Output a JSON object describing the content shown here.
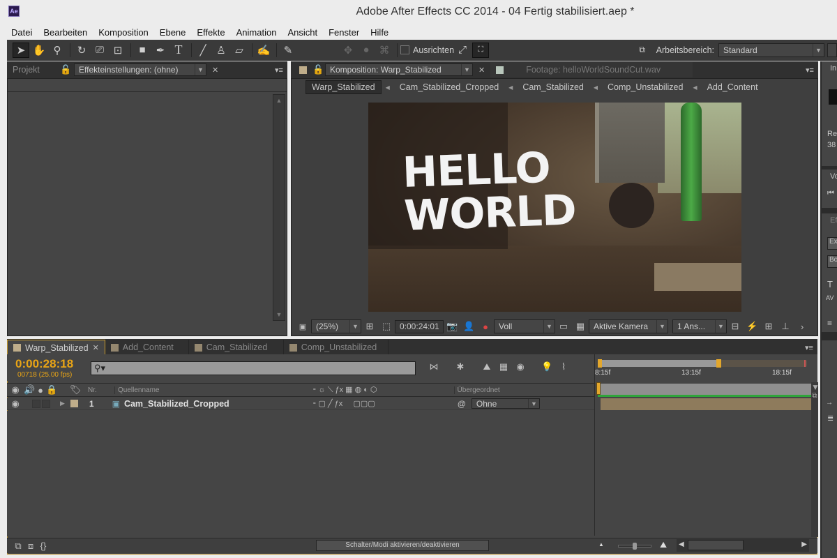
{
  "window": {
    "title": "Adobe After Effects CC 2014 - 04 Fertig stabilisiert.aep *",
    "logo": "Ae"
  },
  "menu": [
    "Datei",
    "Bearbeiten",
    "Komposition",
    "Ebene",
    "Effekte",
    "Animation",
    "Ansicht",
    "Fenster",
    "Hilfe"
  ],
  "toolbar": {
    "tools": [
      {
        "name": "selection-tool-icon",
        "glyph": "➤"
      },
      {
        "name": "hand-tool-icon",
        "glyph": "✋"
      },
      {
        "name": "zoom-tool-icon",
        "glyph": "🔍"
      },
      {
        "name": "rotation-tool-icon",
        "glyph": "↻"
      },
      {
        "name": "camera-tool-icon",
        "glyph": "⎚"
      },
      {
        "name": "pan-behind-tool-icon",
        "glyph": "⊡"
      },
      {
        "name": "rectangle-tool-icon",
        "glyph": "■"
      },
      {
        "name": "pen-tool-icon",
        "glyph": "✒"
      },
      {
        "name": "type-tool-icon",
        "glyph": "T"
      },
      {
        "name": "brush-tool-icon",
        "glyph": "╱"
      },
      {
        "name": "clone-stamp-tool-icon",
        "glyph": "♙"
      },
      {
        "name": "eraser-tool-icon",
        "glyph": "▱"
      },
      {
        "name": "roto-brush-tool-icon",
        "glyph": "✍"
      },
      {
        "name": "puppet-pin-tool-icon",
        "glyph": "📌"
      }
    ],
    "snap_label": "Ausrichten",
    "workspace_label": "Arbeitsbereich:",
    "workspace_value": "Standard"
  },
  "left_panel": {
    "tabs": [
      {
        "label": "Projekt",
        "active": false
      },
      {
        "label": "Effekteinstellungen: (ohne)",
        "active": true
      }
    ]
  },
  "comp_panel": {
    "tab_active": "Komposition: Warp_Stabilized",
    "tab_inactive": "Footage: helloWorldSoundCut.wav",
    "breadcrumbs": [
      "Warp_Stabilized",
      "Cam_Stabilized_Cropped",
      "Cam_Stabilized",
      "Comp_Unstabilized",
      "Add_Content"
    ],
    "viewer_text": [
      "HELLO",
      "WORLD"
    ],
    "zoom": "(25%)",
    "timecode": "0:00:24:01",
    "resolution": "Voll",
    "camera": "Aktive Kamera",
    "views": "1 Ans..."
  },
  "right_panel": {
    "labels": [
      "In",
      "Re",
      "38",
      "Vo",
      "Ef",
      "Ex",
      "Bo"
    ]
  },
  "timeline": {
    "tabs": [
      {
        "label": "Warp_Stabilized",
        "active": true
      },
      {
        "label": "Add_Content",
        "active": false
      },
      {
        "label": "Cam_Stabilized",
        "active": false
      },
      {
        "label": "Comp_Unstabilized",
        "active": false
      }
    ],
    "current_time": "0:00:28:18",
    "frame_info": "00718 (25.00 fps)",
    "search_placeholder": "⚲▾",
    "columns": {
      "nr": "Nr.",
      "source": "Quellenname",
      "parent": "Übergeordnet"
    },
    "layers": [
      {
        "nr": "1",
        "name": "Cam_Stabilized_Cropped",
        "parent": "Ohne"
      }
    ],
    "ruler_ticks": [
      "8:15f",
      "13:15f",
      "18:15f"
    ],
    "toggle_button": "Schalter/Modi aktivieren/deaktivieren"
  },
  "colors": {
    "accent": "#e8a416",
    "panel": "#454545",
    "layer_bar": "#8e7b5c",
    "green": "#2fa43a"
  }
}
